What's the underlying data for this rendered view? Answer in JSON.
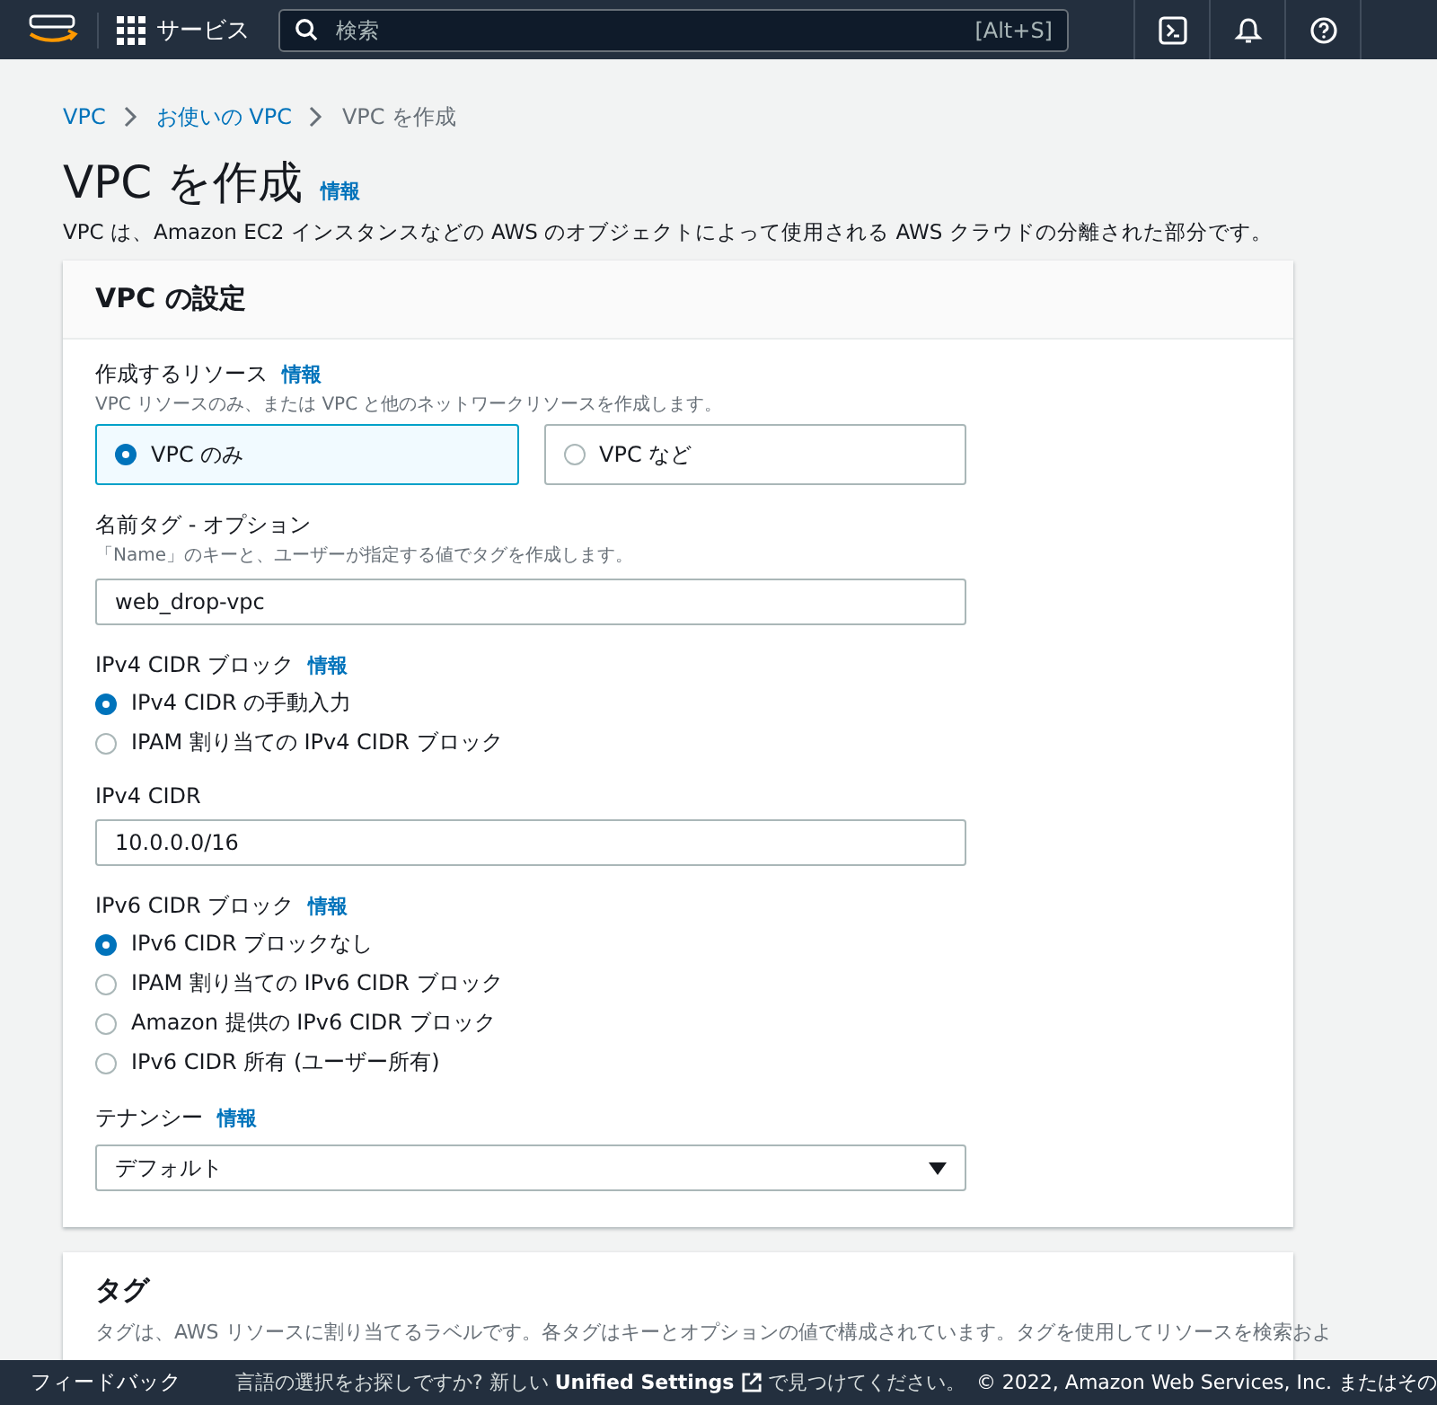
{
  "nav": {
    "services": "サービス",
    "search": {
      "placeholder": "検索",
      "shortcut": "[Alt+S]"
    }
  },
  "breadcrumb": [
    {
      "label": "VPC",
      "link": true
    },
    {
      "label": "お使いの VPC",
      "link": true
    },
    {
      "label": "VPC を作成",
      "link": false
    }
  ],
  "page": {
    "title": "VPC を作成",
    "info": "情報",
    "description": "VPC は、Amazon EC2 インスタンスなどの AWS のオブジェクトによって使用される AWS クラウドの分離された部分です。"
  },
  "settings": {
    "title": "VPC の設定",
    "fields": [
      {
        "kind": "tiles",
        "label": "作成するリソース",
        "info": "情報",
        "hint": "VPC リソースのみ、または VPC と他のネットワークリソースを作成します。",
        "options": [
          {
            "label": "VPC のみ",
            "selected": true
          },
          {
            "label": "VPC など",
            "selected": false
          }
        ]
      },
      {
        "kind": "text",
        "label": "名前タグ - オプション",
        "hint": "「Name」のキーと、ユーザーが指定する値でタグを作成します。",
        "value": "web_drop-vpc"
      },
      {
        "kind": "radios",
        "label": "IPv4 CIDR ブロック",
        "info": "情報",
        "options": [
          {
            "label": "IPv4 CIDR の手動入力",
            "selected": true
          },
          {
            "label": "IPAM 割り当ての IPv4 CIDR ブロック",
            "selected": false
          }
        ]
      },
      {
        "kind": "text",
        "label": "IPv4 CIDR",
        "value": "10.0.0.0/16"
      },
      {
        "kind": "radios",
        "label": "IPv6 CIDR ブロック",
        "info": "情報",
        "options": [
          {
            "label": "IPv6 CIDR ブロックなし",
            "selected": true
          },
          {
            "label": "IPAM 割り当ての IPv6 CIDR ブロック",
            "selected": false
          },
          {
            "label": "Amazon 提供の IPv6 CIDR ブロック",
            "selected": false
          },
          {
            "label": "IPv6 CIDR 所有 (ユーザー所有)",
            "selected": false
          }
        ]
      },
      {
        "kind": "select",
        "label": "テナンシー",
        "info": "情報",
        "value": "デフォルト"
      }
    ]
  },
  "tags": {
    "title": "タグ",
    "description": "タグは、AWS リソースに割り当てるラベルです。各タグはキーとオプションの値で構成されています。タグを使用してリソースを検索およ"
  },
  "footer": {
    "feedback": "フィードバック",
    "notice_before": "言語の選択をお探しですか? 新しい",
    "notice_link": "Unified Settings",
    "notice_after": "で見つけてください。",
    "copyright": "© 2022, Amazon Web Services, Inc. またはその"
  }
}
